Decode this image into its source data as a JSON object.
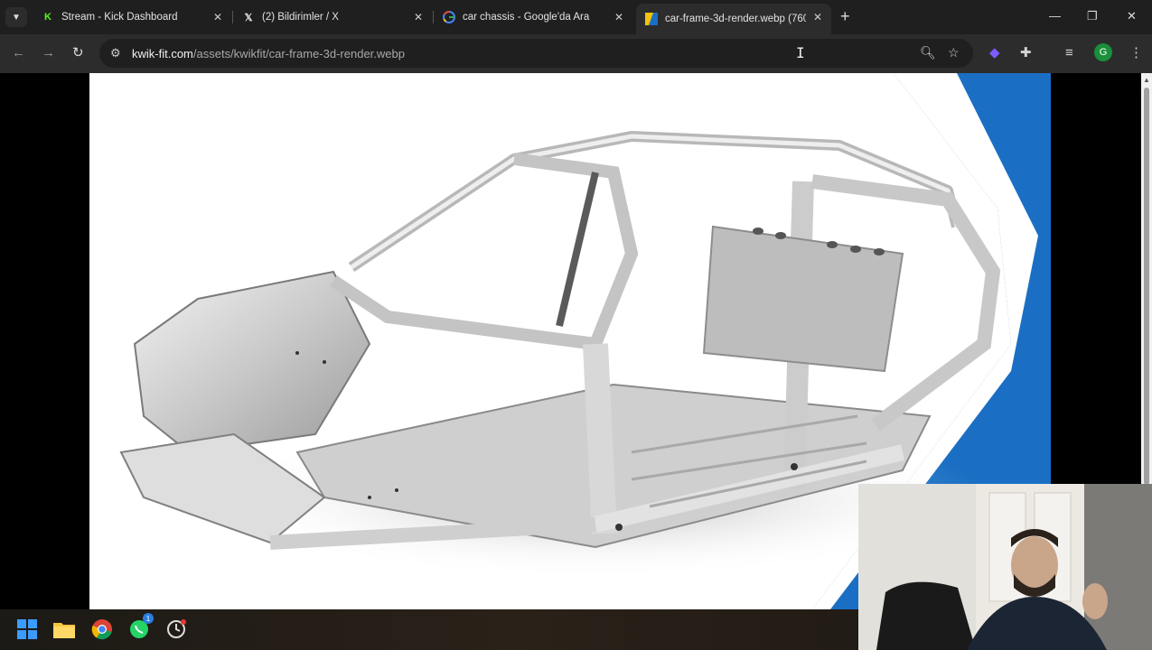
{
  "browser": {
    "tabs": [
      {
        "title": "Stream - Kick Dashboard",
        "favicon": "kick-icon",
        "active": false
      },
      {
        "title": "(2) Bildirimler / X",
        "favicon": "x-icon",
        "active": false
      },
      {
        "title": "car chassis - Google'da Ara",
        "favicon": "google-icon",
        "active": false
      },
      {
        "title": "car-frame-3d-render.webp (760",
        "favicon": "image-icon",
        "active": true
      }
    ],
    "address_bar": {
      "host": "kwik-fit.com",
      "path": "/assets/kwikfit/car-frame-3d-render.webp"
    },
    "profile_initial": "G"
  },
  "taskbar": {
    "whatsapp_badge": "1"
  },
  "colors": {
    "accent_blue": "#1a6fc4",
    "kick_green": "#53fc18",
    "profile_green": "#1b8f3a"
  }
}
